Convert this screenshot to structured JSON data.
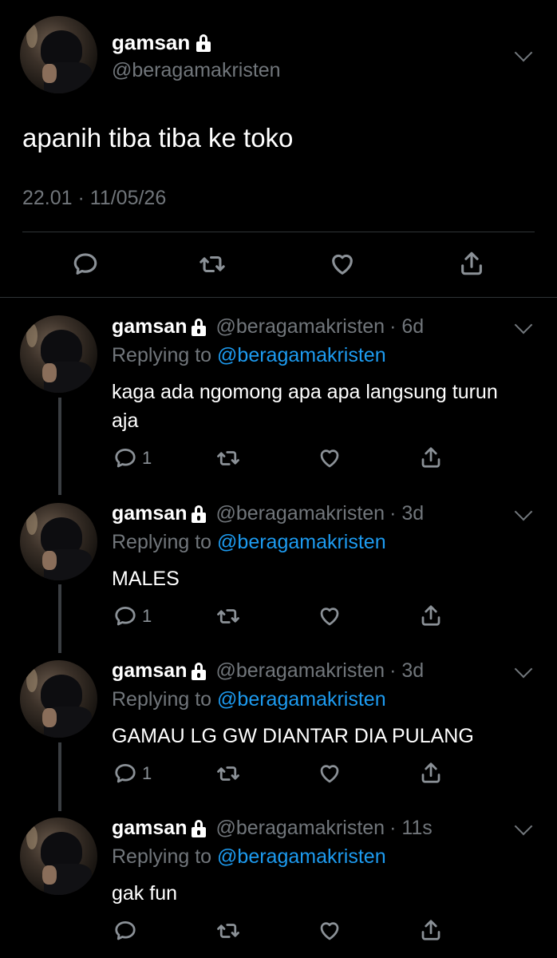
{
  "main_tweet": {
    "name": "gamsan",
    "handle": "@beragamakristen",
    "text": "apanih tiba tiba ke toko",
    "meta": "22.01 · 11/05/26"
  },
  "replies": [
    {
      "name": "gamsan",
      "handle": "@beragamakristen",
      "time": "· 6d",
      "replying_label": "Replying to ",
      "replying_to": "@beragamakristen",
      "text": "kaga ada ngomong apa apa langsung turun aja",
      "reply_count": "1"
    },
    {
      "name": "gamsan",
      "handle": "@beragamakristen",
      "time": "· 3d",
      "replying_label": "Replying to ",
      "replying_to": "@beragamakristen",
      "text": "MALES",
      "reply_count": "1"
    },
    {
      "name": "gamsan",
      "handle": "@beragamakristen",
      "time": "· 3d",
      "replying_label": "Replying to ",
      "replying_to": "@beragamakristen",
      "text": "GAMAU LG GW DIANTAR DIA PULANG",
      "reply_count": "1"
    },
    {
      "name": "gamsan",
      "handle": "@beragamakristen",
      "time": "· 11s",
      "replying_label": "Replying to ",
      "replying_to": "@beragamakristen",
      "text": "gak fun",
      "reply_count": ""
    }
  ],
  "icons": {
    "reply": "speech-bubble-icon",
    "retweet": "retweet-icon",
    "like": "heart-icon",
    "share": "share-icon",
    "lock": "lock-icon",
    "more": "chevron-down-icon"
  },
  "colors": {
    "background": "#000000",
    "mention": "#1d9bf0",
    "secondary_text": "#71767b"
  }
}
